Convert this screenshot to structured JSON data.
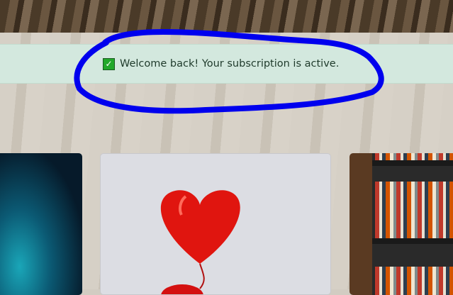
{
  "banner": {
    "icon": "check-mark-button-icon",
    "message": "Welcome back! Your subscription is active."
  },
  "annotation": {
    "shape": "ellipse",
    "color": "#0000ee"
  },
  "cards": [
    {
      "image": "starry-night-sky"
    },
    {
      "image": "red-heart-balloons"
    },
    {
      "image": "bookshelf"
    }
  ]
}
